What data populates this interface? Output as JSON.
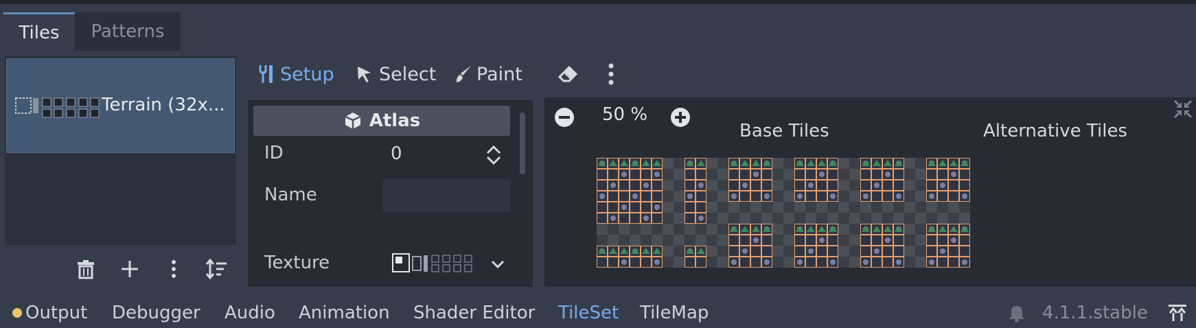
{
  "tabs": [
    {
      "label": "Tiles",
      "active": true
    },
    {
      "label": "Patterns",
      "active": false
    }
  ],
  "sources": [
    {
      "label": "Terrain (32x..."
    }
  ],
  "source_actions": {
    "delete_icon": "trash-icon",
    "add_icon": "plus-icon",
    "menu_icon": "kebab-icon",
    "sort_icon": "sort-icon"
  },
  "toolbar": {
    "setup_label": "Setup",
    "select_label": "Select",
    "paint_label": "Paint",
    "eraser_icon": "eraser-icon",
    "more_icon": "kebab-icon"
  },
  "atlas": {
    "header": "Atlas",
    "id_label": "ID",
    "id_value": "0",
    "name_label": "Name",
    "name_value": "",
    "texture_label": "Texture"
  },
  "view": {
    "zoom_text": "50 %",
    "base_title": "Base Tiles",
    "alt_title": "Alternative Tiles"
  },
  "bottom_tabs": [
    {
      "label": "Output",
      "active": false
    },
    {
      "label": "Debugger",
      "active": false
    },
    {
      "label": "Audio",
      "active": false
    },
    {
      "label": "Animation",
      "active": false
    },
    {
      "label": "Shader Editor",
      "active": false
    },
    {
      "label": "TileSet",
      "active": true
    },
    {
      "label": "TileMap",
      "active": false
    }
  ],
  "version": "4.1.1.stable",
  "colors": {
    "accent": "#79acee",
    "output_dot": "#e9c46a",
    "tile_outline": "#e7a06f",
    "grass": "#3d8a5a"
  }
}
